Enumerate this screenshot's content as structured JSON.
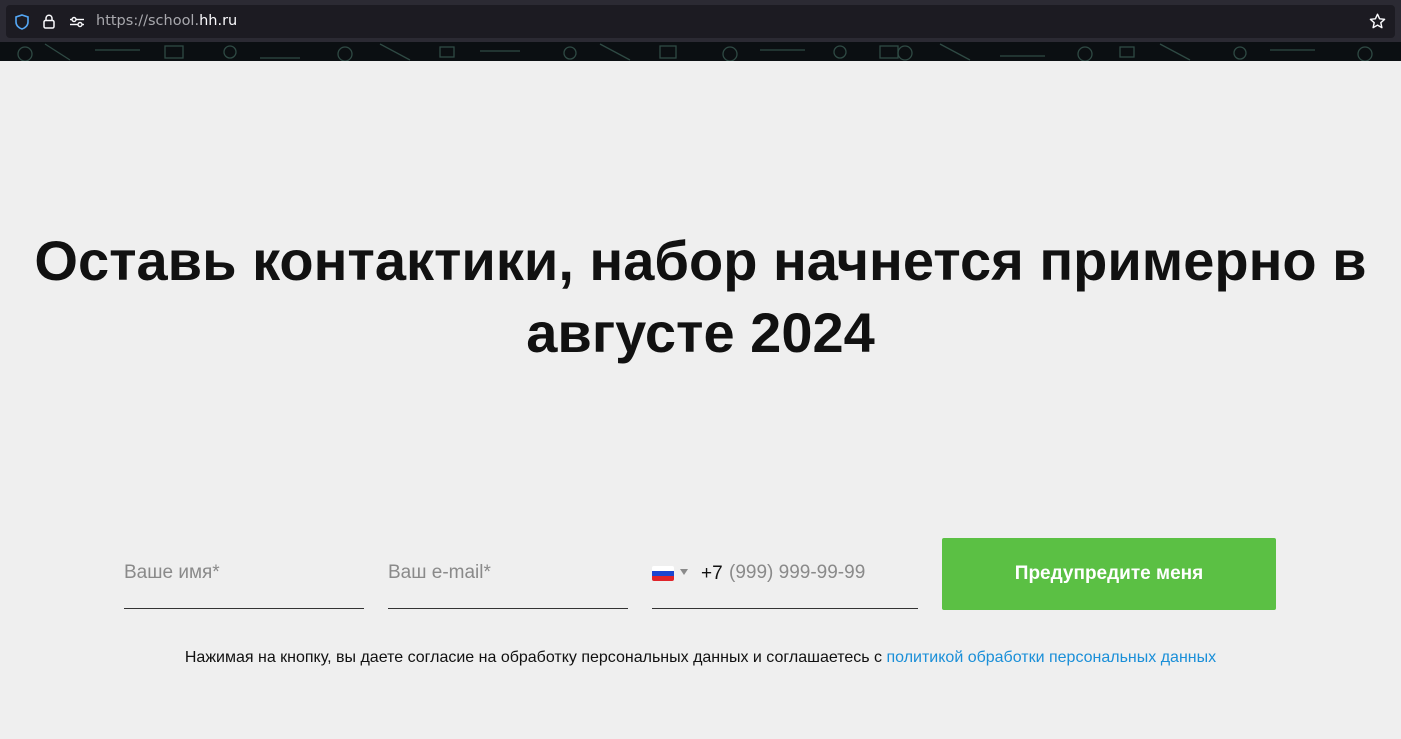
{
  "browser": {
    "url_prefix": "https://school.",
    "url_domain": "hh.ru"
  },
  "headline": {
    "line1": "Оставь контактики, набор начнется примерно в",
    "line2": "августе 2024"
  },
  "form": {
    "name_placeholder": "Ваше имя*",
    "email_placeholder": "Ваш e-mail*",
    "phone_country_code": "+7",
    "phone_placeholder": "(999) 999-99-99",
    "submit_label": "Предупредите меня"
  },
  "consent": {
    "text": "Нажимая на кнопку, вы даете согласие на обработку персональных данных и соглашаетесь с",
    "link_text": "политикой обработки персональных данных"
  },
  "colors": {
    "button": "#5bc044",
    "link": "#1a8fd8",
    "background": "#efefef"
  }
}
